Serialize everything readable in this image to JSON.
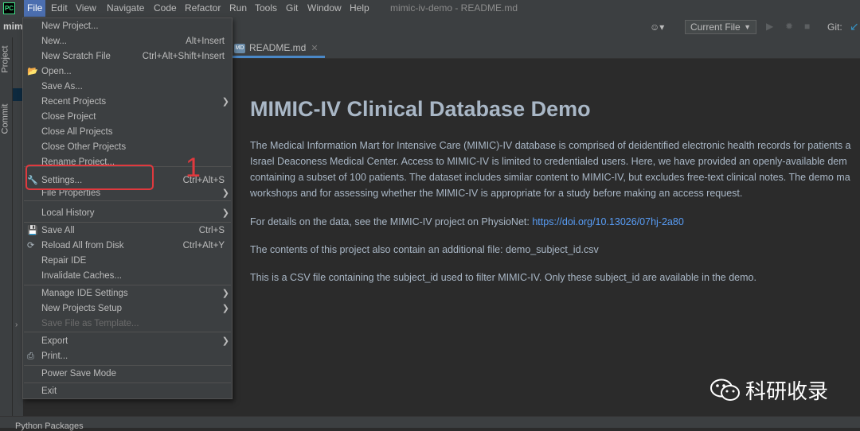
{
  "menubar": {
    "items": [
      "File",
      "Edit",
      "View",
      "Navigate",
      "Code",
      "Refactor",
      "Run",
      "Tools",
      "Git",
      "Window",
      "Help"
    ],
    "window_title": "mimic-iv-demo - README.md"
  },
  "toolbar": {
    "project_crumb": "mim",
    "run_config": "Current File",
    "git_label": "Git:"
  },
  "left_strip": {
    "project_tab": "Project",
    "commit_tab": "Commit"
  },
  "editor": {
    "tab_label": "README.md",
    "tab_icon_text": "MD",
    "title": "MIMIC-IV Clinical Database Demo",
    "paragraphs": [
      "The Medical Information Mart for Intensive Care (MIMIC)-IV database is comprised of deidentified electronic health records for patients a",
      "Israel Deaconess Medical Center. Access to MIMIC-IV is limited to credentialed users. Here, we have provided an openly-available dem",
      "containing a subset of 100 patients. The dataset includes similar content to MIMIC-IV, but excludes free-text clinical notes. The demo ma",
      "workshops and for assessing whether the MIMIC-IV is appropriate for a study before making an access request."
    ],
    "details_prefix": "For details on the data, see the MIMIC-IV project on PhysioNet: ",
    "doi_link": "https://doi.org/10.13026/07hj-2a80",
    "contents_line": "The contents of this project also contain an additional file: demo_subject_id.csv",
    "csv_line": "This is a CSV file containing the subject_id used to filter MIMIC-IV. Only these subject_id are available in the demo."
  },
  "file_menu": {
    "items": [
      {
        "label": "New Project...",
        "shortcut": "",
        "submenu": false,
        "icon": ""
      },
      {
        "label": "New...",
        "shortcut": "Alt+Insert",
        "submenu": false,
        "icon": ""
      },
      {
        "label": "New Scratch File",
        "shortcut": "Ctrl+Alt+Shift+Insert",
        "submenu": false,
        "icon": ""
      },
      {
        "label": "Open...",
        "shortcut": "",
        "submenu": false,
        "icon": "folder-icon"
      },
      {
        "label": "Save As...",
        "shortcut": "",
        "submenu": false,
        "icon": ""
      },
      {
        "label": "Recent Projects",
        "shortcut": "",
        "submenu": true,
        "icon": ""
      },
      {
        "label": "Close Project",
        "shortcut": "",
        "submenu": false,
        "icon": ""
      },
      {
        "label": "Close All Projects",
        "shortcut": "",
        "submenu": false,
        "icon": ""
      },
      {
        "label": "Close Other Projects",
        "shortcut": "",
        "submenu": false,
        "icon": ""
      },
      {
        "label": "Rename Project...",
        "shortcut": "",
        "submenu": false,
        "icon": ""
      },
      {
        "label": "Settings...",
        "shortcut": "Ctrl+Alt+S",
        "submenu": false,
        "icon": "wrench-icon"
      },
      {
        "label": "File Properties",
        "shortcut": "",
        "submenu": true,
        "icon": ""
      },
      {
        "label": "Local History",
        "shortcut": "",
        "submenu": true,
        "icon": ""
      },
      {
        "label": "Save All",
        "shortcut": "Ctrl+S",
        "submenu": false,
        "icon": "save-icon"
      },
      {
        "label": "Reload All from Disk",
        "shortcut": "Ctrl+Alt+Y",
        "submenu": false,
        "icon": "reload-icon"
      },
      {
        "label": "Repair IDE",
        "shortcut": "",
        "submenu": false,
        "icon": ""
      },
      {
        "label": "Invalidate Caches...",
        "shortcut": "",
        "submenu": false,
        "icon": ""
      },
      {
        "label": "Manage IDE Settings",
        "shortcut": "",
        "submenu": true,
        "icon": ""
      },
      {
        "label": "New Projects Setup",
        "shortcut": "",
        "submenu": true,
        "icon": ""
      },
      {
        "label": "Save File as Template...",
        "shortcut": "",
        "submenu": false,
        "icon": "",
        "disabled": true
      },
      {
        "label": "Export",
        "shortcut": "",
        "submenu": true,
        "icon": ""
      },
      {
        "label": "Print...",
        "shortcut": "",
        "submenu": false,
        "icon": "print-icon"
      },
      {
        "label": "Power Save Mode",
        "shortcut": "",
        "submenu": false,
        "icon": ""
      },
      {
        "label": "Exit",
        "shortcut": "",
        "submenu": false,
        "icon": ""
      }
    ]
  },
  "annotation": {
    "number": "1"
  },
  "bottom": {
    "tool_window": "Python Packages"
  },
  "watermark": {
    "text": "科研收录"
  },
  "colors": {
    "accent": "#4b6eaf",
    "highlight_box": "#e0393e",
    "link": "#589df6"
  }
}
